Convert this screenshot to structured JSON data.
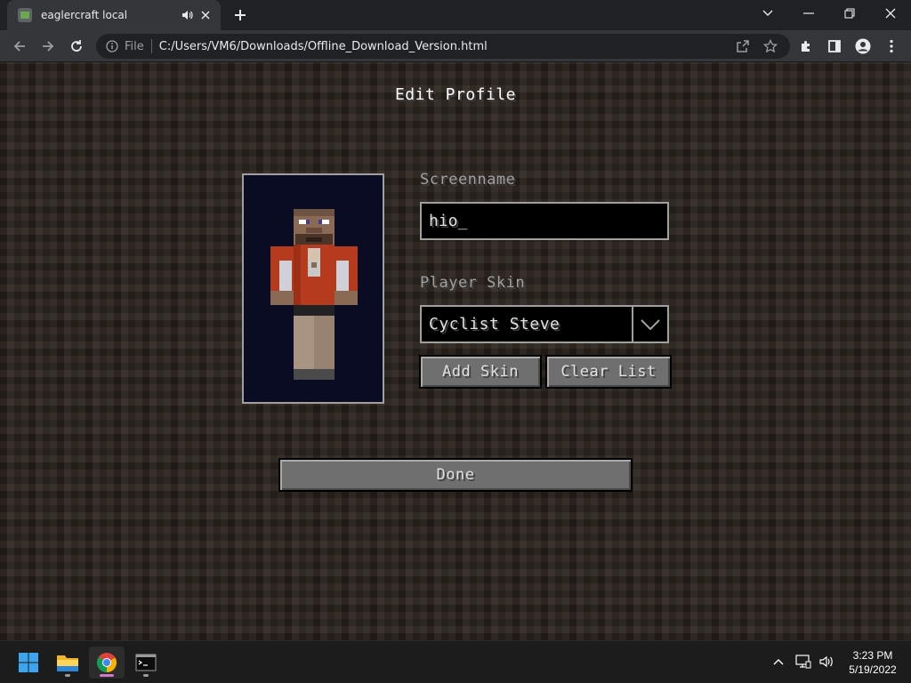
{
  "browser": {
    "tab_title": "eaglercraft local",
    "scheme_label": "File",
    "url": "C:/Users/VM6/Downloads/Offline_Download_Version.html"
  },
  "game": {
    "title": "Edit Profile",
    "screenname_label": "Screenname",
    "screenname_value": "hio_",
    "skin_label": "Player Skin",
    "skin_selected": "Cyclist Steve",
    "add_skin_button": "Add Skin",
    "clear_list_button": "Clear List",
    "done_button": "Done"
  },
  "taskbar": {
    "apps": [
      "start-icon",
      "file-explorer-icon",
      "chrome-icon",
      "terminal-icon"
    ],
    "active_app": "chrome-icon",
    "clock_time": "3:23 PM",
    "clock_date": "5/19/2022"
  },
  "colors": {
    "button_face": "#6f6f6f",
    "text_label": "#a0a0a0",
    "skin_bg": "#0a0c24",
    "jacket": "#b53a1e",
    "taskbar_active": "#d278c8"
  }
}
